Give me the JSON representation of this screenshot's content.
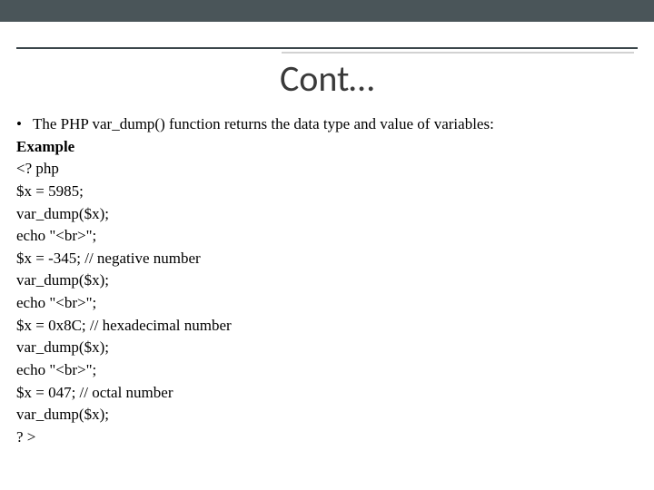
{
  "title": "Cont…",
  "bullet": "The PHP var_dump() function returns the data type and value of variables:",
  "example_label": "Example",
  "code": [
    "<? php",
    "$x = 5985;",
    "var_dump($x);",
    "echo \"<br>\";",
    "$x = -345; // negative number",
    "var_dump($x);",
    "echo \"<br>\";",
    "$x = 0x8C; // hexadecimal number",
    "var_dump($x);",
    "echo \"<br>\";",
    "$x = 047; // octal number",
    "var_dump($x);",
    "? >"
  ]
}
